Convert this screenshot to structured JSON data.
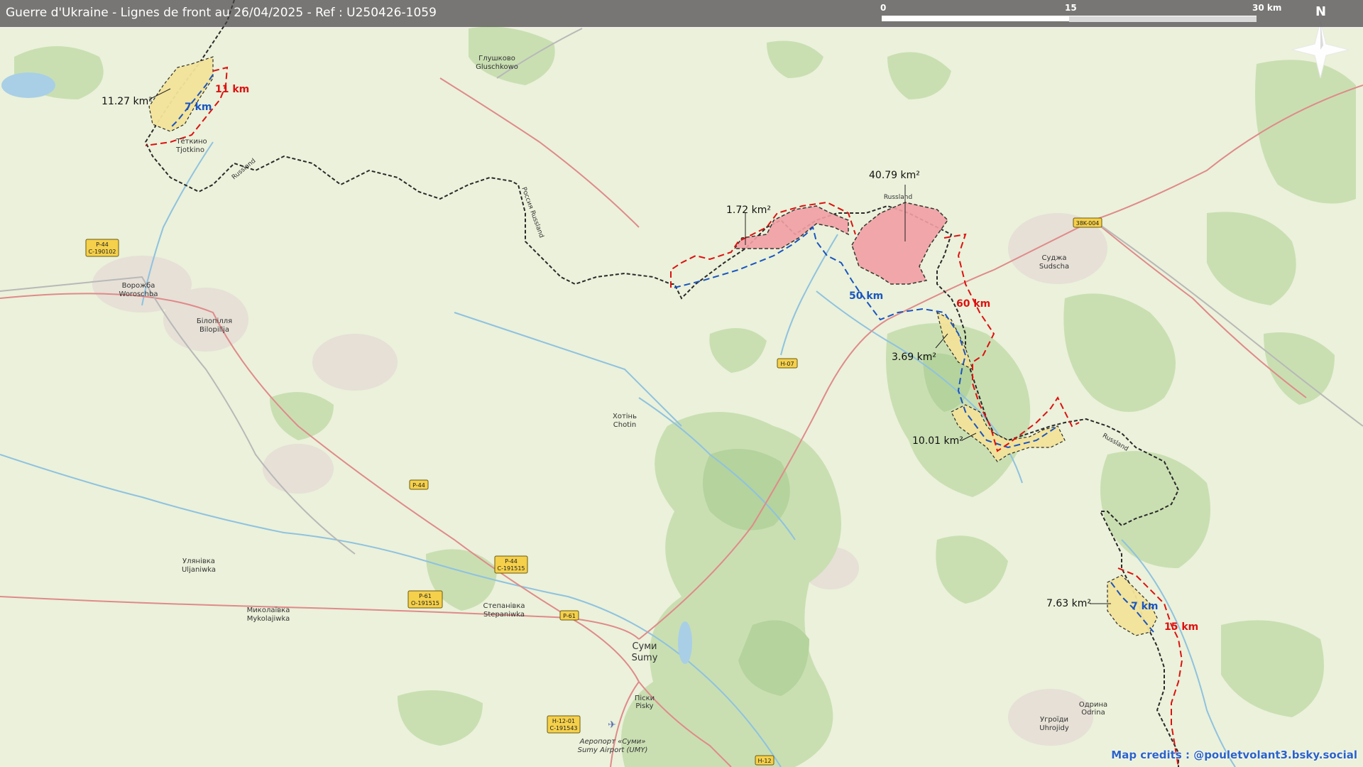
{
  "header": {
    "title": "Guerre d'Ukraine - Lignes de front au 26/04/2025 - Ref : U250426-1059",
    "scale_labels": [
      "0",
      "15",
      "30 km"
    ],
    "north": "N"
  },
  "areas": {
    "nw_yellow": "11.27 km²",
    "pink_small": "1.72 km²",
    "pink_large": "40.79 km²",
    "yellow_mid": "3.69 km²",
    "yellow_lower": "10.01 km²",
    "yellow_se": "7.63 km²"
  },
  "distances": {
    "nw_red": "11 km",
    "nw_blue": "7 km",
    "center_blue": "50 km",
    "center_red": "60 km",
    "se_blue": "7 km",
    "se_red": "15 km"
  },
  "places": {
    "glushkovo_1": "Глушково",
    "glushkovo_2": "Gluschkowo",
    "tyotkino_1": "Тёткино",
    "tyotkino_2": "Tjotkino",
    "vorozhba_1": "Ворожба",
    "vorozhba_2": "Woroschba",
    "bilopillia_1": "Білопілля",
    "bilopillia_2": "Bilopillja",
    "khotin_1": "Хотінь",
    "khotin_2": "Chotin",
    "sudzha_1": "Суджа",
    "sudzha_2": "Sudscha",
    "ulianivka_1": "Улянівка",
    "ulianivka_2": "Uljaniwka",
    "mykolaivka_1": "Миколаївка",
    "mykolaivka_2": "Mykolajiwka",
    "stepanivka_1": "Степанівка",
    "stepanivka_2": "Stepaniwka",
    "sumy_1": "Суми",
    "sumy_2": "Sumy",
    "pisky_1": "Піски",
    "pisky_2": "Pisky",
    "uhroidy_1": "Угроїди",
    "uhroidy_2": "Uhrojidy",
    "odnorobivka_1": "Одрина",
    "odnorobivka_2": "Odrina",
    "airport_1": "Аеропорт «Суми»",
    "airport_2": "Sumy Airport (UMY)",
    "russland_1": "Russland",
    "russland_2": "Russland",
    "russland_3": "Russland",
    "rossiya": "Россия Russland"
  },
  "roads": {
    "p44_a": "P-44",
    "p44_a2": "C-190102",
    "p44_b": "P-44",
    "p44_c": "P-44",
    "p44_c2": "C-191515",
    "p61_a": "P-61",
    "p61_a2": "O-191515",
    "p61_b": "P-61",
    "h07": "H-07",
    "r38k": "38K-004",
    "h1201": "H-12-01",
    "h1201_2": "C-191543",
    "h12": "H-12"
  },
  "colors": {
    "red_line": "#dd1111",
    "blue_line": "#1a55c0",
    "border": "#2a2a2a",
    "pink_fill": "#f2a0a4",
    "yellow_fill": "#f3e39a",
    "forest": "#c7dfb0",
    "water": "#a9cfe6",
    "road": "#e08a8a"
  },
  "credits": "Map credits : @pouletvolant3.bsky.social"
}
